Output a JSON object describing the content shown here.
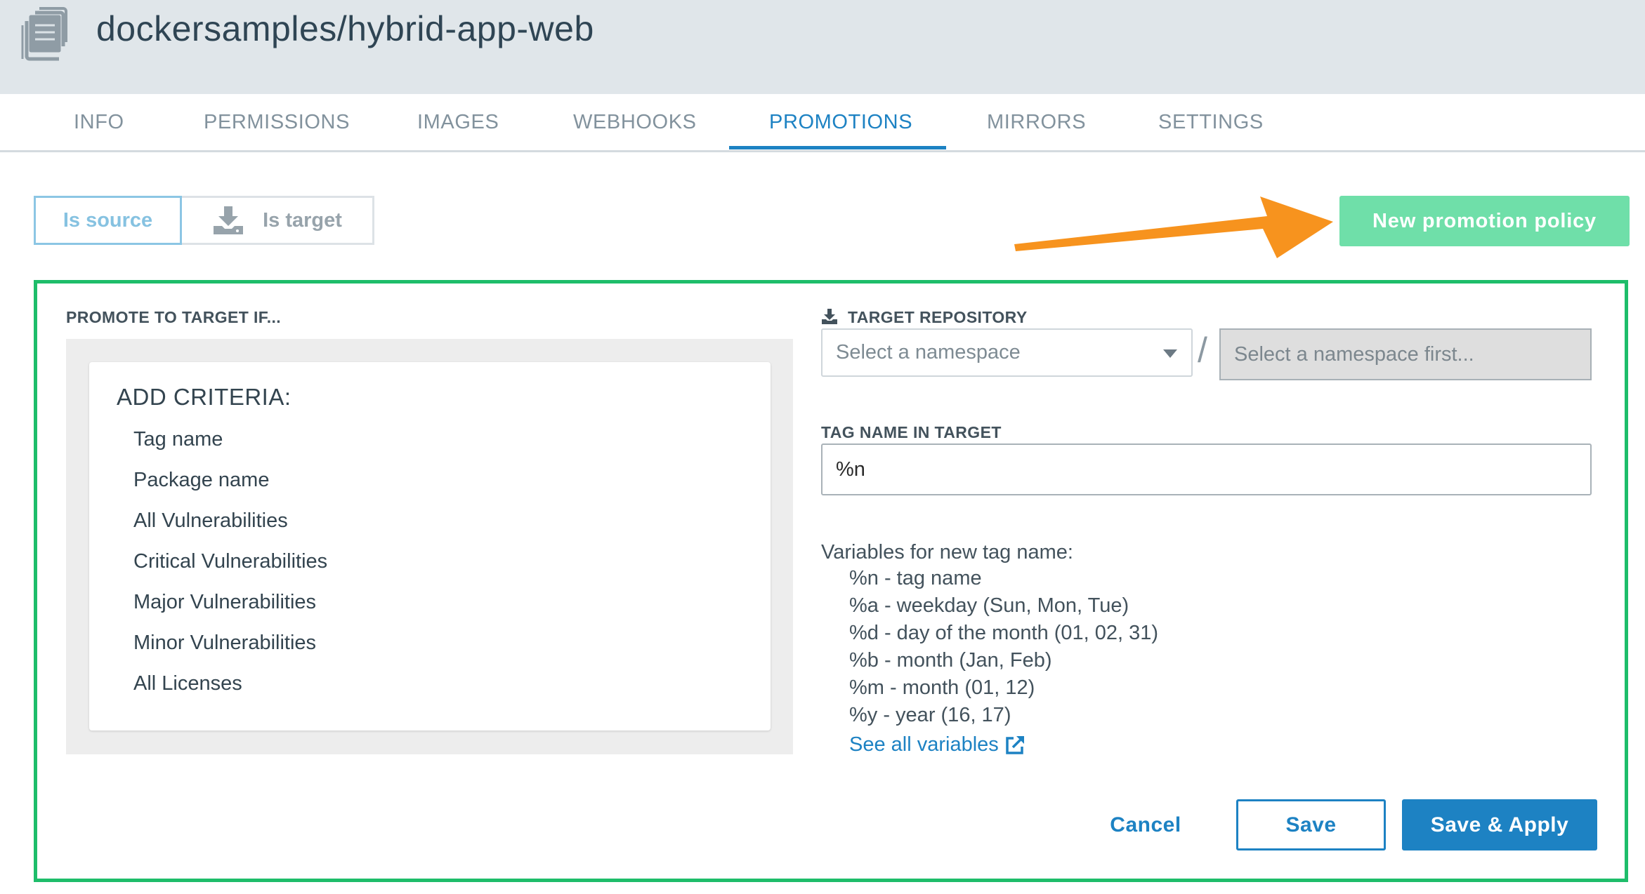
{
  "header": {
    "icon": "repository-stack-icon",
    "title": "dockersamples/hybrid-app-web"
  },
  "tabs": [
    {
      "label": "INFO"
    },
    {
      "label": "PERMISSIONS"
    },
    {
      "label": "IMAGES"
    },
    {
      "label": "WEBHOOKS"
    },
    {
      "label": "PROMOTIONS",
      "active": true
    },
    {
      "label": "MIRRORS"
    },
    {
      "label": "SETTINGS"
    }
  ],
  "toggle": {
    "source_label": "Is source",
    "target_label": "Is target",
    "target_icon": "download-icon",
    "selected": "source"
  },
  "new_policy_button": "New promotion policy",
  "annotation_arrow_color": "#f7931e",
  "policy": {
    "criteria_section_label": "PROMOTE TO TARGET IF...",
    "criteria_title": "ADD CRITERIA:",
    "criteria_items": [
      "Tag name",
      "Package name",
      "All Vulnerabilities",
      "Critical Vulnerabilities",
      "Major Vulnerabilities",
      "Minor Vulnerabilities",
      "All Licenses"
    ],
    "target_repo_label": "TARGET REPOSITORY",
    "namespace_placeholder": "Select a namespace",
    "separator": "/",
    "repo_placeholder": "Select a namespace first...",
    "tag_name_label": "TAG NAME IN TARGET",
    "tag_name_value": "%n",
    "variables_title": "Variables for new tag name:",
    "variables": [
      "%n - tag name",
      "%a - weekday (Sun, Mon, Tue)",
      "%d - day of the month (01, 02, 31)",
      "%b - month (Jan, Feb)",
      "%m - month (01, 12)",
      "%y - year (16, 17)"
    ],
    "see_all_link": "See all variables"
  },
  "actions": {
    "cancel": "Cancel",
    "save": "Save",
    "save_apply": "Save & Apply"
  },
  "colors": {
    "accent": "#1d82c3",
    "panel_border": "#1ebd6a",
    "new_policy_bg": "#6fdfa9",
    "header_bg": "#e0e6ea"
  }
}
